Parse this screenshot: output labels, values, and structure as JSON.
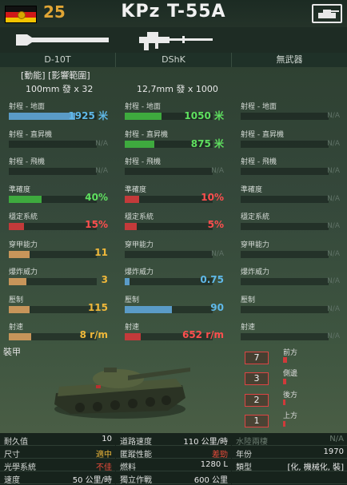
{
  "header": {
    "tier": "25",
    "title": "KPz T-55A"
  },
  "columns": [
    "D-10T",
    "DShK",
    "無武器"
  ],
  "ammo": [
    {
      "line1": "[動能] [影響範圍]",
      "line2": "100mm 發 x 32"
    },
    {
      "line1": "",
      "line2": "12,7mm 發 x 1000"
    }
  ],
  "stats": [
    [
      {
        "label": "射程 - 地面",
        "value": "1925 米",
        "fill": 0.75,
        "color": "#5a9bc7",
        "vcolor": "#5fb8e8"
      },
      {
        "label": "射程 - 地面",
        "value": "1050 米",
        "fill": 0.42,
        "color": "#3eaa3e",
        "vcolor": "#5fe05f"
      },
      {
        "label": "射程 - 地面",
        "value": "N/A",
        "fill": 0,
        "na": true
      }
    ],
    [
      {
        "label": "射程 - 直昇機",
        "value": "N/A",
        "fill": 0,
        "na": true
      },
      {
        "label": "射程 - 直昇機",
        "value": "875 米",
        "fill": 0.34,
        "color": "#3eaa3e",
        "vcolor": "#5fe05f"
      },
      {
        "label": "射程 - 直昇機",
        "value": "N/A",
        "fill": 0,
        "na": true
      }
    ],
    [
      {
        "label": "射程 - 飛機",
        "value": "N/A",
        "fill": 0,
        "na": true
      },
      {
        "label": "射程 - 飛機",
        "value": "N/A",
        "fill": 0,
        "na": true
      },
      {
        "label": "射程 - 飛機",
        "value": "N/A",
        "fill": 0,
        "na": true
      }
    ],
    [
      {
        "label": "準確度",
        "value": "40%",
        "fill": 0.37,
        "color": "#3eaa3e",
        "vcolor": "#5fe05f"
      },
      {
        "label": "準確度",
        "value": "10%",
        "fill": 0.16,
        "color": "#c33a3a",
        "vcolor": "#ff4e4e"
      },
      {
        "label": "準確度",
        "value": "N/A",
        "fill": 0,
        "na": true
      }
    ],
    [
      {
        "label": "穩定系統",
        "value": "15%",
        "fill": 0.17,
        "color": "#c33a3a",
        "vcolor": "#ff4e4e"
      },
      {
        "label": "穩定系統",
        "value": "5%",
        "fill": 0.14,
        "color": "#c33a3a",
        "vcolor": "#ff4e4e"
      },
      {
        "label": "穩定系統",
        "value": "N/A",
        "fill": 0,
        "na": true
      }
    ],
    [
      {
        "label": "穿甲能力",
        "value": "11",
        "fill": 0.24,
        "color": "#c7955a",
        "vcolor": "#f0b83a"
      },
      {
        "label": "穿甲能力",
        "value": "N/A",
        "fill": 0,
        "na": true
      },
      {
        "label": "穿甲能力",
        "value": "N/A",
        "fill": 0,
        "na": true
      }
    ],
    [
      {
        "label": "爆炸威力",
        "value": "3",
        "fill": 0.2,
        "color": "#c7955a",
        "vcolor": "#f0b83a"
      },
      {
        "label": "爆炸威力",
        "value": "0.75",
        "fill": 0.05,
        "color": "#5a9bc7",
        "vcolor": "#5fb8e8"
      },
      {
        "label": "爆炸威力",
        "value": "N/A",
        "fill": 0,
        "na": true
      }
    ],
    [
      {
        "label": "壓制",
        "value": "115",
        "fill": 0.24,
        "color": "#c7955a",
        "vcolor": "#f0b83a"
      },
      {
        "label": "壓制",
        "value": "90",
        "fill": 0.54,
        "color": "#5a9bc7",
        "vcolor": "#5fb8e8"
      },
      {
        "label": "壓制",
        "value": "N/A",
        "fill": 0,
        "na": true
      }
    ],
    [
      {
        "label": "射速",
        "value": "8 r/m",
        "fill": 0.25,
        "color": "#c7955a",
        "vcolor": "#f0b83a"
      },
      {
        "label": "射速",
        "value": "652 r/m",
        "fill": 0.18,
        "color": "#c33a3a",
        "vcolor": "#ff4e4e"
      },
      {
        "label": "射速",
        "value": "N/A",
        "fill": 0,
        "na": true
      }
    ]
  ],
  "armor": {
    "title": "裝甲",
    "front": {
      "label": "前方",
      "value": "7"
    },
    "side": {
      "label": "側邊",
      "value": "3"
    },
    "rear": {
      "label": "後方",
      "value": "2"
    },
    "top": {
      "label": "上方",
      "value": "1"
    }
  },
  "specs": [
    [
      {
        "k": "耐久值",
        "v": "10"
      },
      {
        "k": "道路速度",
        "v": "110 公里/時"
      },
      {
        "k": "水陸兩棲",
        "v": "N/A",
        "dim": true
      }
    ],
    [
      {
        "k": "尺寸",
        "v": "適中",
        "hl": true
      },
      {
        "k": "匿蹤性能",
        "v": "差勁",
        "warn": true
      },
      {
        "k": "年份",
        "v": "1970"
      }
    ],
    [
      {
        "k": "光學系統",
        "v": "不佳",
        "warn": true
      },
      {
        "k": "燃料",
        "v": "1280 L"
      },
      {
        "k": "類型",
        "v": "[化, 機械化, 裝]"
      }
    ],
    [
      {
        "k": "速度",
        "v": "50 公里/時"
      },
      {
        "k": "獨立作戰",
        "v": "600 公里"
      },
      {
        "k": "",
        "v": ""
      }
    ]
  ],
  "colors": {
    "accent_orange": "#e0a535",
    "good": "#5fe05f",
    "bad": "#ff4e4e",
    "blue": "#5fb8e8"
  }
}
